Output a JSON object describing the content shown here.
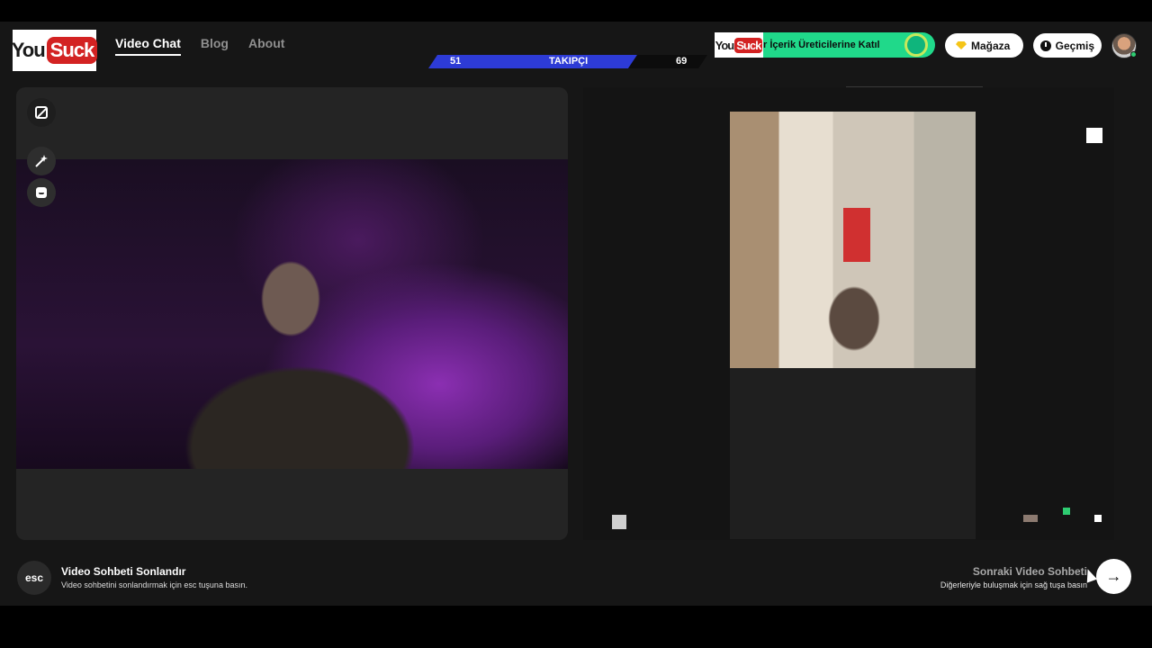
{
  "brand": {
    "logo_part1": "You",
    "logo_part2": "Suck"
  },
  "nav": {
    "items": [
      "Video Chat",
      "Blog",
      "About"
    ],
    "active": "Video Chat"
  },
  "follow_bar": {
    "left_count": "51",
    "label": "TAKIPÇI",
    "right_count": "69"
  },
  "creator_banner": {
    "logo_part1": "You",
    "logo_part2": "Suck",
    "text": "r İçerik Üreticilerine Katıl"
  },
  "header_buttons": {
    "shop": "Mağaza",
    "history": "Geçmiş"
  },
  "bottom": {
    "esc_key": "esc",
    "end_title": "Video Sohbeti Sonlandır",
    "end_subtitle": "Video sohbetini sonlandırmak için esc tuşuna basın.",
    "next_title": "Sonraki Video Sohbeti",
    "next_subtitle": "Diğerleriyle buluşmak için sağ tuşa basın",
    "next_arrow": "→"
  },
  "colors": {
    "accent_blue": "#2d3bd6",
    "banner_green": "#20d98a",
    "logo_red": "#d32222"
  }
}
